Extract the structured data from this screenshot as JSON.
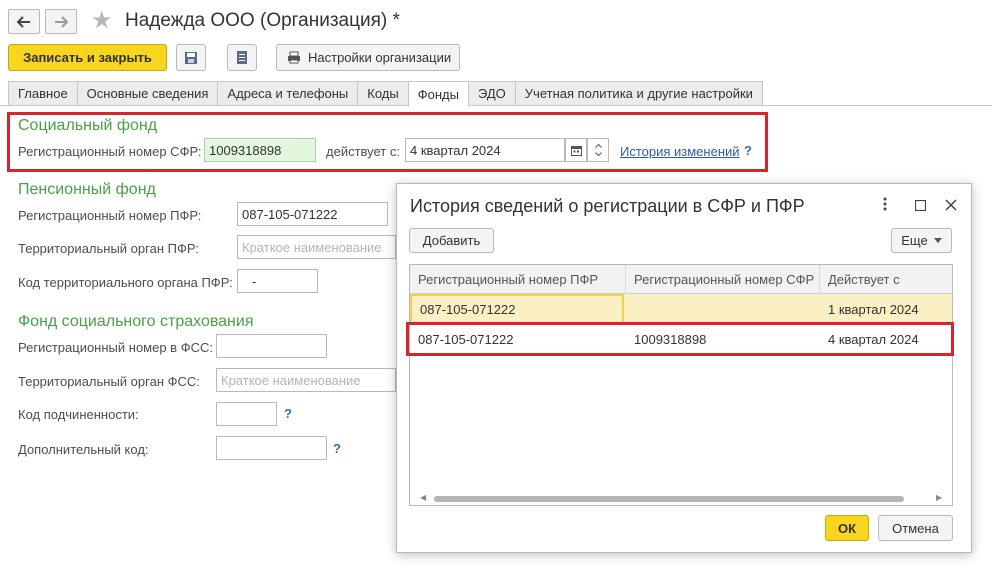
{
  "window": {
    "title": "Надежда ООО (Организация) *",
    "back_icon": "arrow-left-icon",
    "forward_icon": "arrow-right-icon",
    "favorite_icon": "star-icon"
  },
  "toolbar": {
    "save_close_label": "Записать и закрыть",
    "save_icon": "floppy-disk-icon",
    "report_icon": "document-icon",
    "print_icon": "printer-icon",
    "org_settings_label": "Настройки организации"
  },
  "tabs": [
    {
      "label": "Главное"
    },
    {
      "label": "Основные сведения"
    },
    {
      "label": "Адреса и телефоны"
    },
    {
      "label": "Коды"
    },
    {
      "label": "Фонды",
      "active": true
    },
    {
      "label": "ЭДО"
    },
    {
      "label": "Учетная политика и другие настройки"
    }
  ],
  "social_fund": {
    "title": "Социальный фонд",
    "reg_label": "Регистрационный номер СФР:",
    "reg_value": "1009318898",
    "valid_from_label": "действует с:",
    "valid_from_value": "4 квартал 2024",
    "history_link": "История изменений",
    "help": "?"
  },
  "pension_fund": {
    "title": "Пенсионный фонд",
    "reg_label": "Регистрационный номер ПФР:",
    "reg_value": "087-105-071222",
    "terr_label": "Территориальный орган ПФР:",
    "terr_placeholder": "Краткое наименование",
    "code_label": "Код территориального органа ПФР:",
    "code_value": "-"
  },
  "fss": {
    "title": "Фонд социального страхования",
    "reg_label": "Регистрационный номер в ФСС:",
    "terr_label": "Территориальный орган ФСС:",
    "terr_placeholder": "Краткое наименование",
    "sub_code_label": "Код подчиненности:",
    "extra_code_label": "Дополнительный код:",
    "help": "?"
  },
  "dialog": {
    "title": "История сведений о регистрации в СФР и ПФР",
    "more_icon": "vertical-dots-icon",
    "maximize_icon": "maximize-icon",
    "close_icon": "close-icon",
    "add_label": "Добавить",
    "more_label": "Еще",
    "columns": [
      "Регистрационный номер ПФР",
      "Регистрационный номер СФР",
      "Действует с"
    ],
    "rows": [
      {
        "pfr": "087-105-071222",
        "sfr": "",
        "from": "1 квартал 2024"
      },
      {
        "pfr": "087-105-071222",
        "sfr": "1009318898",
        "from": "4 квартал 2024"
      }
    ],
    "ok_label": "ОК",
    "cancel_label": "Отмена"
  },
  "colors": {
    "accent_yellow": "#f8d51e",
    "group_green": "#4a9f47",
    "highlight_red": "#d9232f",
    "link_blue": "#2f5fa8"
  }
}
